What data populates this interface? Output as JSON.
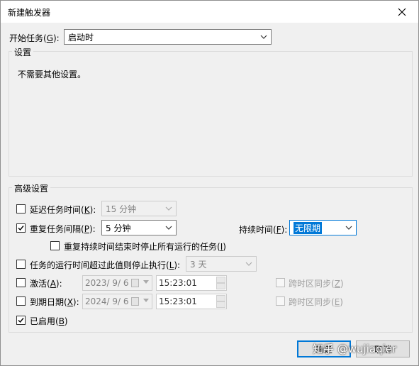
{
  "window": {
    "title": "新建触发器"
  },
  "begin": {
    "label_prefix": "开始任务(",
    "label_key": "G",
    "label_suffix": "):",
    "value": "启动时"
  },
  "settings": {
    "title": "设置",
    "text": "不需要其他设置。"
  },
  "advanced": {
    "title": "高级设置",
    "delay": {
      "label_prefix": "延迟任务时间(",
      "label_key": "K",
      "label_suffix": "):",
      "value": "15 分钟",
      "checked": false
    },
    "repeat": {
      "label_prefix": "重复任务间隔(",
      "label_key": "P",
      "label_suffix": "):",
      "value": "5 分钟",
      "checked": true
    },
    "duration": {
      "label_prefix": "持续时间(",
      "label_key": "F",
      "label_suffix": "):",
      "value": "无限期"
    },
    "stop_all": {
      "label_prefix": "重复持续时间结束时停止所有运行的任务(",
      "label_key": "I",
      "label_suffix": ")",
      "checked": false
    },
    "stop_longer": {
      "label_prefix": "任务的运行时间超过此值则停止执行(",
      "label_key": "L",
      "label_suffix": "):",
      "value": "3 天",
      "checked": false
    },
    "activate": {
      "label_prefix": "激活(",
      "label_key": "A",
      "label_suffix": "):",
      "date": "2023/  9/  6",
      "time": "15:23:01",
      "sync_prefix": "跨时区同步(",
      "sync_key": "Z",
      "sync_suffix": ")",
      "checked": false
    },
    "expire": {
      "label_prefix": "到期日期(",
      "label_key": "X",
      "label_suffix": "):",
      "date": "2024/  9/  6",
      "time": "15:23:01",
      "sync_prefix": "跨时区同步(",
      "sync_key": "E",
      "sync_suffix": ")",
      "checked": false
    },
    "enabled": {
      "label_prefix": "已启用(",
      "label_key": "B",
      "label_suffix": ")",
      "checked": true
    }
  },
  "buttons": {
    "ok": "确定",
    "cancel": "取消"
  },
  "watermark": "知乎 @wujiaqier",
  "colors": {
    "accent": "#0078d7",
    "dialog_bg": "#f0f0f0"
  }
}
